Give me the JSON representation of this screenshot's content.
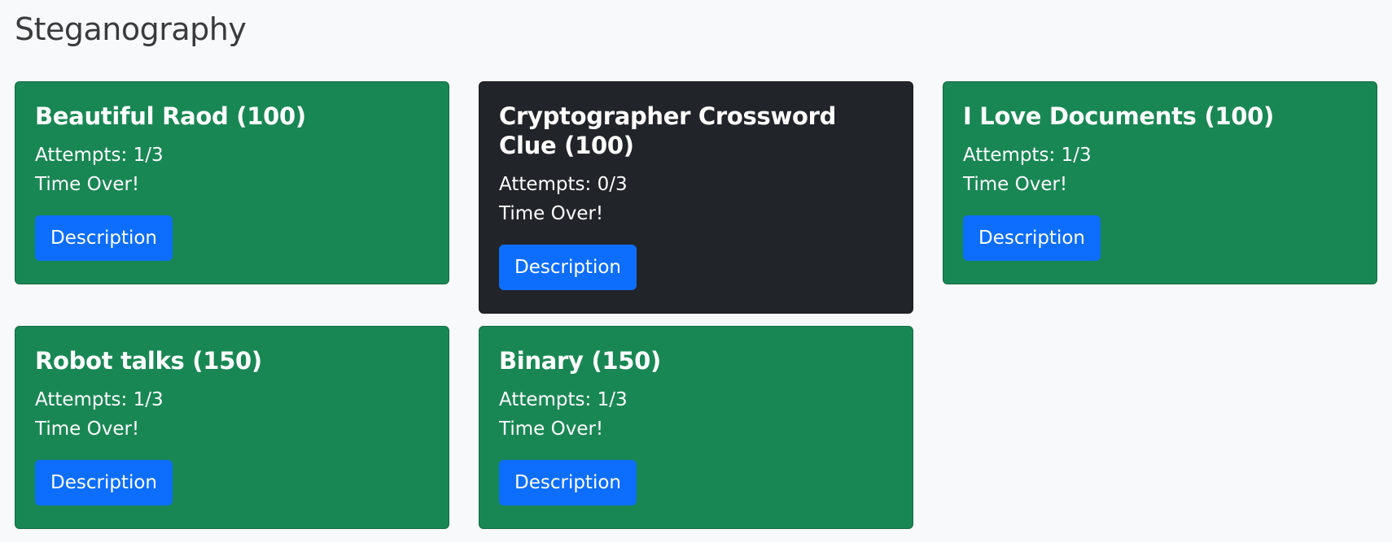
{
  "category": {
    "title": "Steganography"
  },
  "challenges": [
    {
      "title": "Beautiful Raod (100)",
      "attempts": "Attempts: 1/3",
      "status": "Time Over!",
      "button_label": "Description",
      "solved": true
    },
    {
      "title": "Cryptographer Crossword Clue (100)",
      "attempts": "Attempts: 0/3",
      "status": "Time Over!",
      "button_label": "Description",
      "solved": false
    },
    {
      "title": "I Love Documents (100)",
      "attempts": "Attempts: 1/3",
      "status": "Time Over!",
      "button_label": "Description",
      "solved": true
    },
    {
      "title": "Robot talks (150)",
      "attempts": "Attempts: 1/3",
      "status": "Time Over!",
      "button_label": "Description",
      "solved": true
    },
    {
      "title": "Binary (150)",
      "attempts": "Attempts: 1/3",
      "status": "Time Over!",
      "button_label": "Description",
      "solved": true
    }
  ],
  "colors": {
    "solved_card": "#198754",
    "unsolved_card": "#212529",
    "button": "#0d6efd",
    "background": "#f8f9fb"
  }
}
